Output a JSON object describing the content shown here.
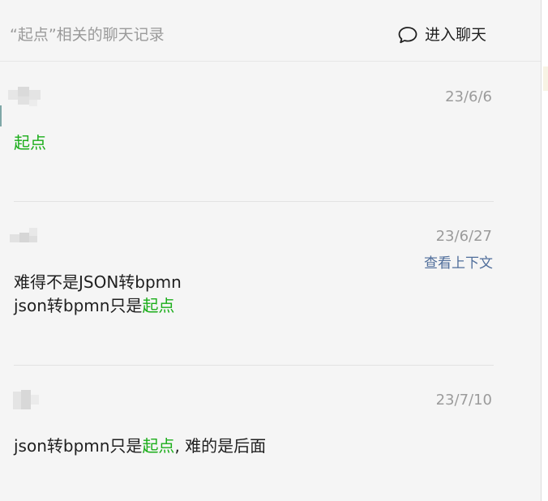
{
  "header": {
    "title": "“起点”相关的聊天记录",
    "enter_chat_label": "进入聊天"
  },
  "results": [
    {
      "date": "23/6/6",
      "lines": [
        {
          "before": "",
          "highlight": "起点",
          "after": ""
        }
      ]
    },
    {
      "date": "23/6/27",
      "context_link": "查看上下文",
      "lines": [
        {
          "before": "难得不是JSON转bpmn",
          "highlight": "",
          "after": ""
        },
        {
          "before": "json转bpmn只是",
          "highlight": "起点",
          "after": ""
        }
      ]
    },
    {
      "date": "23/7/10",
      "lines": [
        {
          "before": "json转bpmn只是",
          "highlight": "起点",
          "after": ", 难的是后面"
        }
      ]
    }
  ],
  "colors": {
    "highlight": "#1aad19",
    "link": "#4f6d9a",
    "panel_bg": "#f5f5f5"
  },
  "icons": {
    "enter_chat": "chat-bubble-icon"
  }
}
